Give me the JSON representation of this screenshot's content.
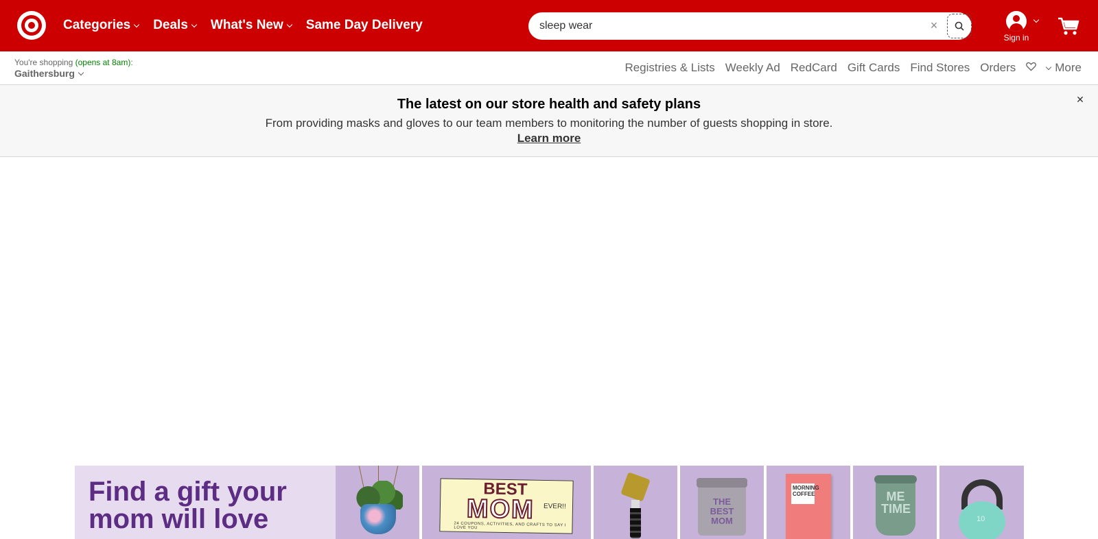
{
  "header": {
    "brand_color": "#cc0000",
    "nav": [
      {
        "label": "Categories",
        "has_dropdown": true
      },
      {
        "label": "Deals",
        "has_dropdown": true
      },
      {
        "label": "What's New",
        "has_dropdown": true
      },
      {
        "label": "Same Day Delivery",
        "has_dropdown": false
      }
    ],
    "search": {
      "value": "sleep wear",
      "clear_icon": "close-icon",
      "button_icon": "search-icon"
    },
    "account": {
      "label": "Sign in"
    },
    "cart_icon": "cart-icon"
  },
  "subheader": {
    "store_prefix": "You're shopping",
    "store_status": "(opens at 8am)",
    "store_suffix": ":",
    "store_name": "Gaithersburg",
    "utility_links": [
      "Registries & Lists",
      "Weekly Ad",
      "RedCard",
      "Gift Cards",
      "Find Stores",
      "Orders"
    ],
    "favorites_icon": "heart-icon",
    "more_label": "More"
  },
  "notice": {
    "title": "The latest on our store health and safety plans",
    "text": "From providing masks and gloves to our team members to monitoring the number of guests shopping in store.",
    "link": "Learn more"
  },
  "promo": {
    "headline": "Find a gift your mom will love",
    "colors": {
      "panel": "#e7dcef",
      "headline": "#5c2d82",
      "tile": "#c7b3d9"
    },
    "products": {
      "card": {
        "best": "BEST",
        "mom": "MOM",
        "ever": "EVER!!",
        "small": "24 COUPONS, ACTIVITIES, AND CRAFTS TO SAY I LOVE YOU"
      },
      "candle": "THE BEST MOM",
      "coffee": "MORNING COFFEE",
      "tumbler": "ME TIME",
      "kettlebell": "10"
    }
  }
}
